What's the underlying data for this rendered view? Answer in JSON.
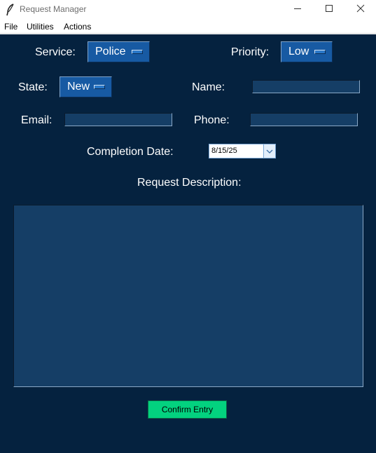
{
  "window": {
    "title": "Request Manager"
  },
  "menu": {
    "items": [
      "File",
      "Utilities",
      "Actions"
    ]
  },
  "form": {
    "service": {
      "label": "Service:",
      "value": "Police"
    },
    "priority": {
      "label": "Priority:",
      "value": "Low"
    },
    "state": {
      "label": "State:",
      "value": "New"
    },
    "name": {
      "label": "Name:",
      "value": ""
    },
    "email": {
      "label": "Email:",
      "value": ""
    },
    "phone": {
      "label": "Phone:",
      "value": ""
    },
    "completion_date": {
      "label": "Completion Date:",
      "value": "8/15/25"
    },
    "description": {
      "label": "Request Description:",
      "value": ""
    }
  },
  "actions": {
    "confirm_label": "Confirm Entry"
  },
  "colors": {
    "background": "#05223f",
    "field": "#153e66",
    "button_blue": "#175aa3",
    "confirm_green": "#03d27f"
  },
  "icons": [
    "feather-icon",
    "minimize-icon",
    "maximize-icon",
    "close-icon",
    "chevron-down-icon"
  ]
}
